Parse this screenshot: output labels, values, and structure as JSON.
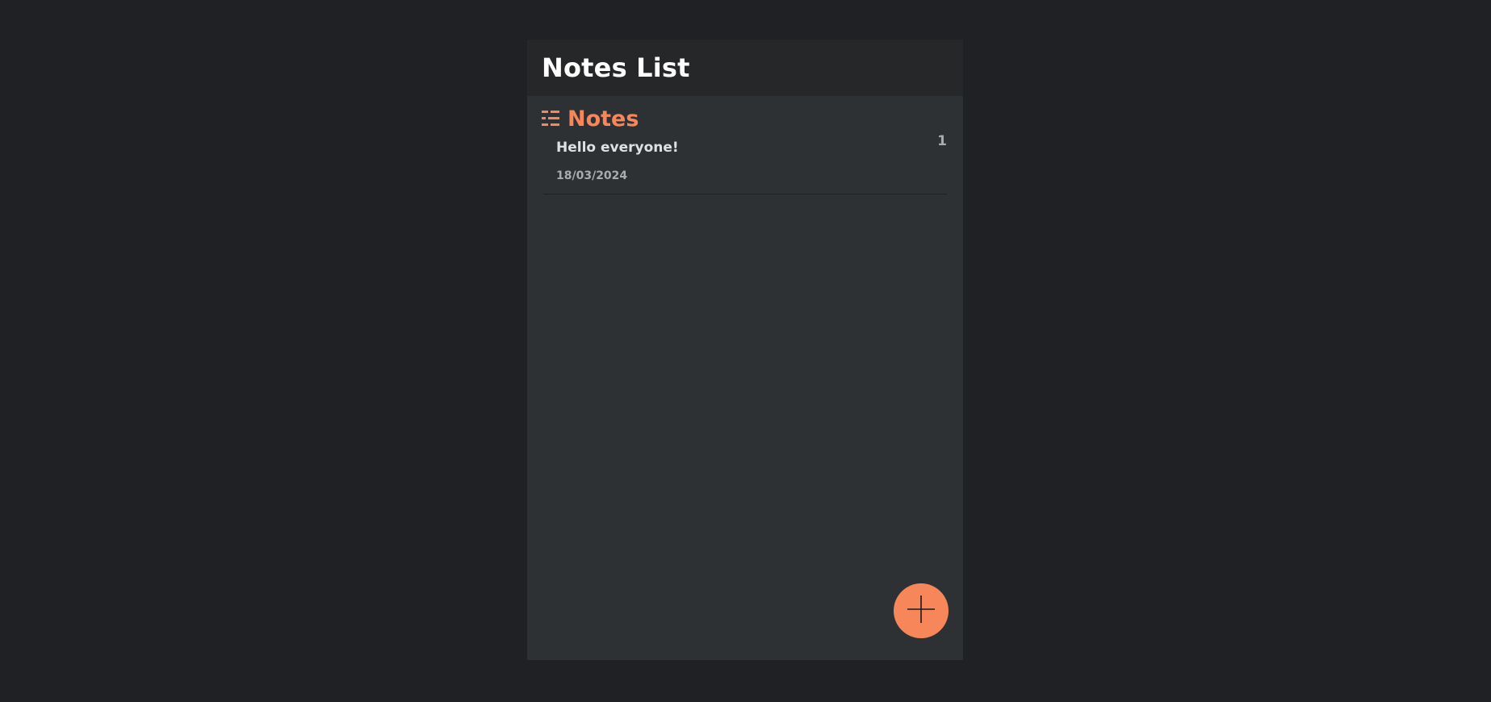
{
  "header": {
    "title": "Notes List"
  },
  "section": {
    "icon": "list-icon",
    "label": "Notes"
  },
  "notes": [
    {
      "title": "Hello everyone!",
      "date": "18/03/2024",
      "count": "1"
    }
  ],
  "fab": {
    "icon": "plus-icon"
  },
  "colors": {
    "page_background": "#202124",
    "panel_background": "#2e3134",
    "header_background": "#262729",
    "accent": "#f7865a",
    "note_title": "#dfe0e2",
    "muted_text": "#a9abad"
  }
}
